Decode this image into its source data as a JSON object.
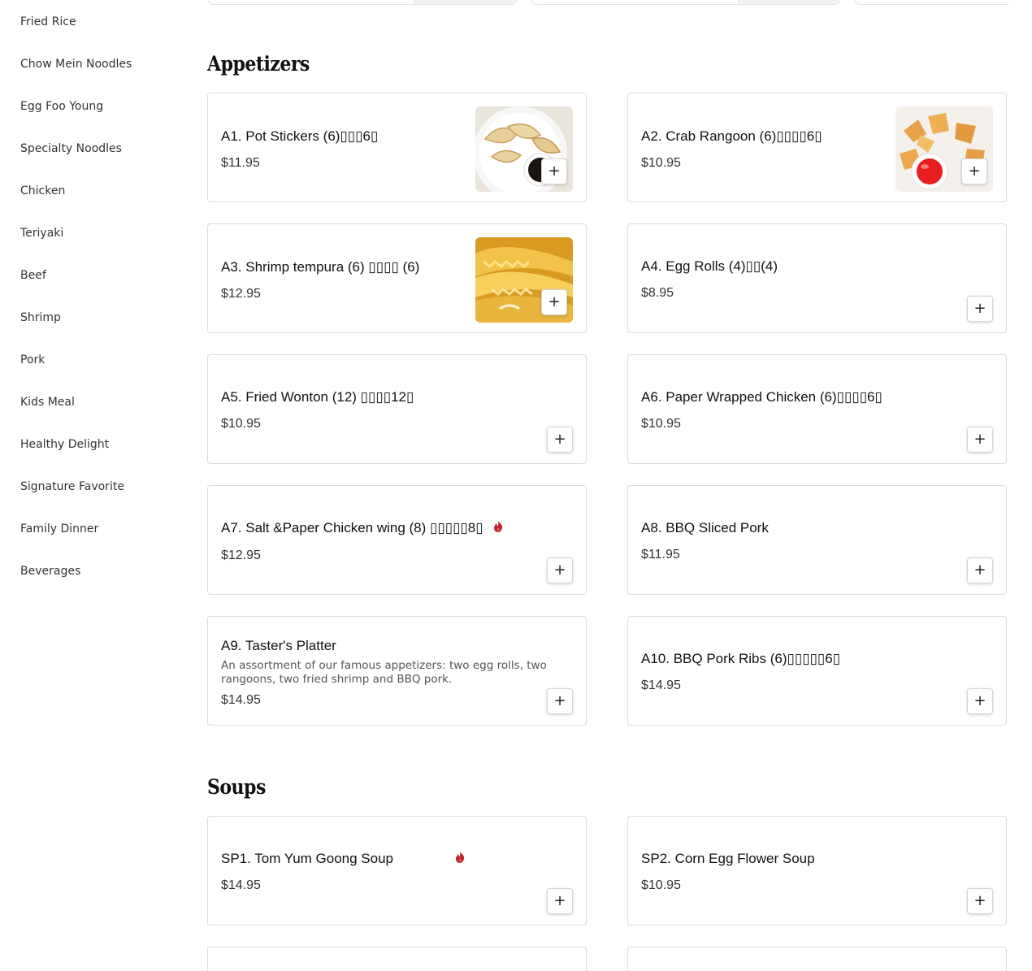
{
  "sidebar": {
    "items": [
      {
        "label": "Fried Rice"
      },
      {
        "label": "Chow Mein Noodles"
      },
      {
        "label": "Egg Foo Young"
      },
      {
        "label": "Specialty Noodles"
      },
      {
        "label": "Chicken"
      },
      {
        "label": "Teriyaki"
      },
      {
        "label": "Beef"
      },
      {
        "label": "Shrimp"
      },
      {
        "label": "Pork"
      },
      {
        "label": "Kids Meal"
      },
      {
        "label": "Healthy Delight"
      },
      {
        "label": "Signature Favorite"
      },
      {
        "label": "Family Dinner"
      },
      {
        "label": "Beverages"
      }
    ]
  },
  "sections": {
    "appetizers": {
      "title": "Appetizers",
      "items": [
        {
          "name": "A1. Pot Stickers (6)▯▯▯6▯",
          "price": "$11.95",
          "image": "potstickers-photo"
        },
        {
          "name": "A2. Crab Rangoon (6)▯▯▯▯6▯",
          "price": "$10.95",
          "image": "crab-rangoon-photo"
        },
        {
          "name": "A3. Shrimp tempura (6) ▯▯▯▯ (6)",
          "price": "$12.95",
          "image": "shrimp-tempura-photo"
        },
        {
          "name": "A4. Egg Rolls (4)▯▯(4)",
          "price": "$8.95"
        },
        {
          "name": "A5. Fried Wonton (12) ▯▯▯▯12▯",
          "price": "$10.95"
        },
        {
          "name": "A6. Paper Wrapped Chicken (6)▯▯▯▯6▯",
          "price": "$10.95"
        },
        {
          "name": "A7. Salt &Paper Chicken wing (8) ▯▯▯▯▯8▯",
          "price": "$12.95",
          "spicy": true
        },
        {
          "name": "A8. BBQ Sliced Pork",
          "price": "$11.95"
        },
        {
          "name": "A9. Taster's Platter",
          "description": "An assortment of our famous appetizers: two egg rolls, two rangoons, two fried shrimp and BBQ pork.",
          "price": "$14.95"
        },
        {
          "name": "A10. BBQ Pork Ribs (6)▯▯▯▯▯6▯",
          "price": "$14.95"
        }
      ]
    },
    "soups": {
      "title": "Soups",
      "items": [
        {
          "name": "SP1. Tom Yum Goong Soup",
          "price": "$14.95",
          "spicy": true
        },
        {
          "name": "SP2. Corn Egg Flower Soup",
          "price": "$10.95"
        }
      ]
    }
  },
  "add_button_label": "+",
  "colors": {
    "spicy": "#c0262d",
    "card_border": "#dcdcdc",
    "sidebar_text": "#333333"
  }
}
